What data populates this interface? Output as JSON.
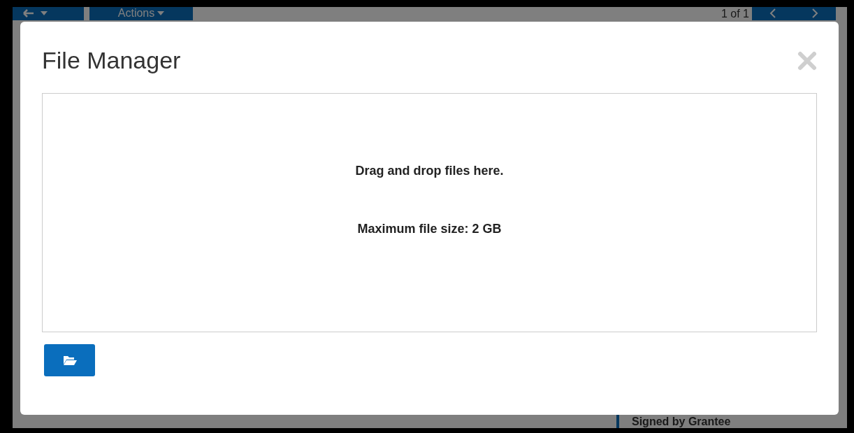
{
  "background": {
    "actions_label": "Actions",
    "pager": "1 of 1",
    "panel_heading": "Signed by Grantee"
  },
  "modal": {
    "title": "File Manager",
    "dropzone": {
      "lines": [
        "Drag and drop files here.",
        "Maximum file size: 2 GB"
      ]
    }
  }
}
